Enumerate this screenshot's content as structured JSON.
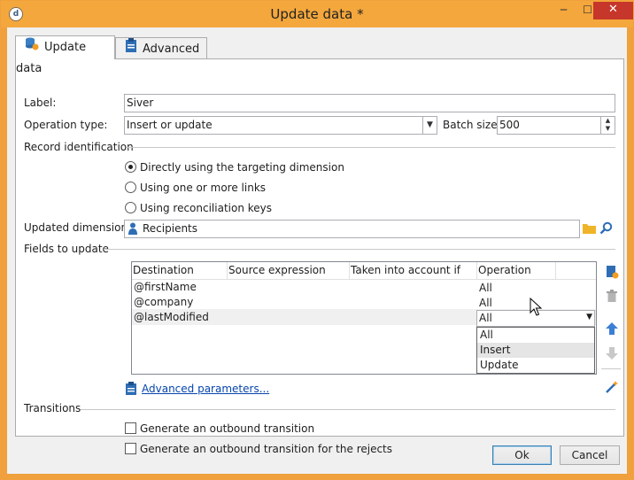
{
  "window": {
    "title": "Update data *",
    "close_glyph": "✕",
    "minimize_glyph": "─",
    "maximize_glyph": "☐"
  },
  "tabs": [
    {
      "label": "Update data",
      "icon": "database-sync-icon"
    },
    {
      "label": "Advanced",
      "icon": "clipboard-icon"
    }
  ],
  "form": {
    "label_caption": "Label:",
    "label_value": "Siver",
    "operation_caption": "Operation type:",
    "operation_value": "Insert or update",
    "batch_caption": "Batch size:",
    "batch_value": "500"
  },
  "record_identification": {
    "heading": "Record identification",
    "options": [
      {
        "label": "Directly using the targeting dimension",
        "selected": true
      },
      {
        "label": "Using one or more links",
        "selected": false
      },
      {
        "label": "Using reconciliation keys",
        "selected": false
      }
    ]
  },
  "dimension": {
    "caption": "Updated dimension:",
    "value": "Recipients"
  },
  "fields": {
    "heading": "Fields to update",
    "columns": [
      "Destination",
      "Source expression",
      "Taken into account if",
      "Operation"
    ],
    "rows": [
      {
        "destination": "@firstName",
        "source": "",
        "condition": "",
        "operation": "All"
      },
      {
        "destination": "@company",
        "source": "",
        "condition": "",
        "operation": "All"
      },
      {
        "destination": "@lastModified",
        "source": "",
        "condition": "",
        "operation": "All"
      }
    ],
    "dropdown_options": [
      "All",
      "Insert",
      "Update"
    ],
    "hovered_option": "Insert"
  },
  "advanced_link": "Advanced parameters...",
  "transitions": {
    "heading": "Transitions",
    "options": [
      {
        "label": "Generate an outbound transition",
        "checked": false
      },
      {
        "label": "Generate an outbound transition for the rejects",
        "checked": false
      }
    ]
  },
  "buttons": {
    "ok": "Ok",
    "cancel": "Cancel"
  },
  "colors": {
    "titlebar": "#f4a73c",
    "close": "#c7362a",
    "link": "#0645ad",
    "arrow": "#3c7fd4"
  }
}
